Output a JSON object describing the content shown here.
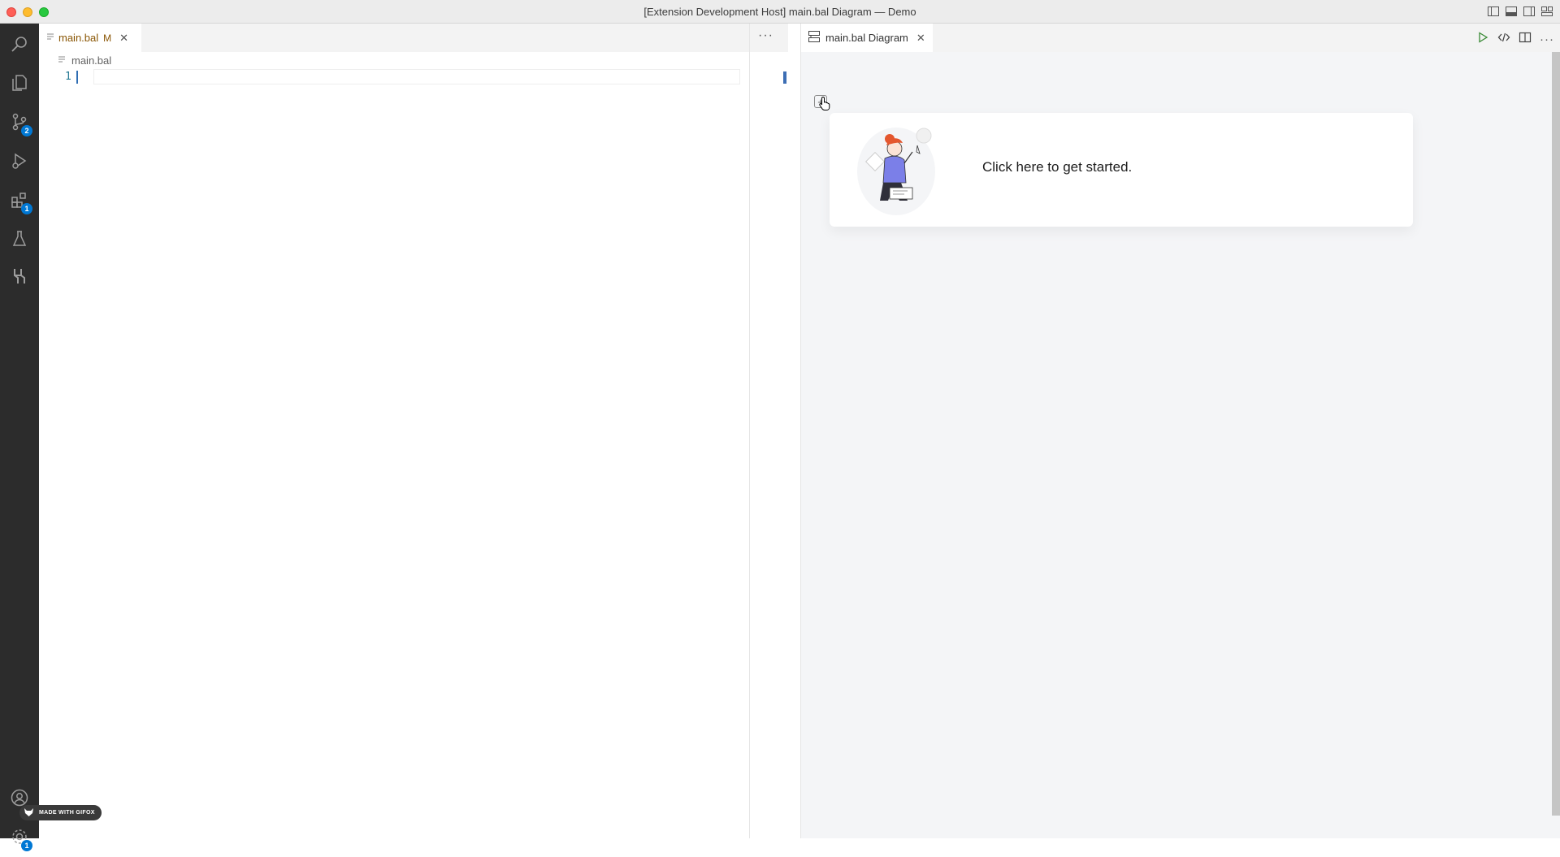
{
  "window": {
    "title": "[Extension Development Host] main.bal Diagram — Demo"
  },
  "activity_bar": {
    "items": [
      {
        "name": "search",
        "icon": "search-icon"
      },
      {
        "name": "explorer",
        "icon": "files-icon"
      },
      {
        "name": "source-control",
        "icon": "source-control-icon",
        "badge": "2"
      },
      {
        "name": "run-debug",
        "icon": "run-debug-icon"
      },
      {
        "name": "extensions",
        "icon": "extensions-icon",
        "badge": "1"
      },
      {
        "name": "testing",
        "icon": "beaker-icon"
      },
      {
        "name": "ballerina",
        "icon": "ballerina-icon"
      }
    ],
    "bottom": [
      {
        "name": "accounts",
        "icon": "account-icon"
      },
      {
        "name": "manage",
        "icon": "gear-icon",
        "badge": "1"
      }
    ]
  },
  "left_editor": {
    "tab": {
      "label": "main.bal",
      "modified": "M"
    },
    "more_actions": "···",
    "breadcrumb": "main.bal",
    "line_number": "1"
  },
  "right_editor": {
    "tab": {
      "label": "main.bal Diagram"
    },
    "more_actions": "···",
    "start_card_text": "Click here to get started."
  },
  "watermark": {
    "text": "MADE WITH GIFOX"
  },
  "colors": {
    "activity_bar": "#2c2c2c",
    "badge": "#0078d4",
    "modified": "#895503",
    "diagram_bg": "#f4f5f7"
  }
}
